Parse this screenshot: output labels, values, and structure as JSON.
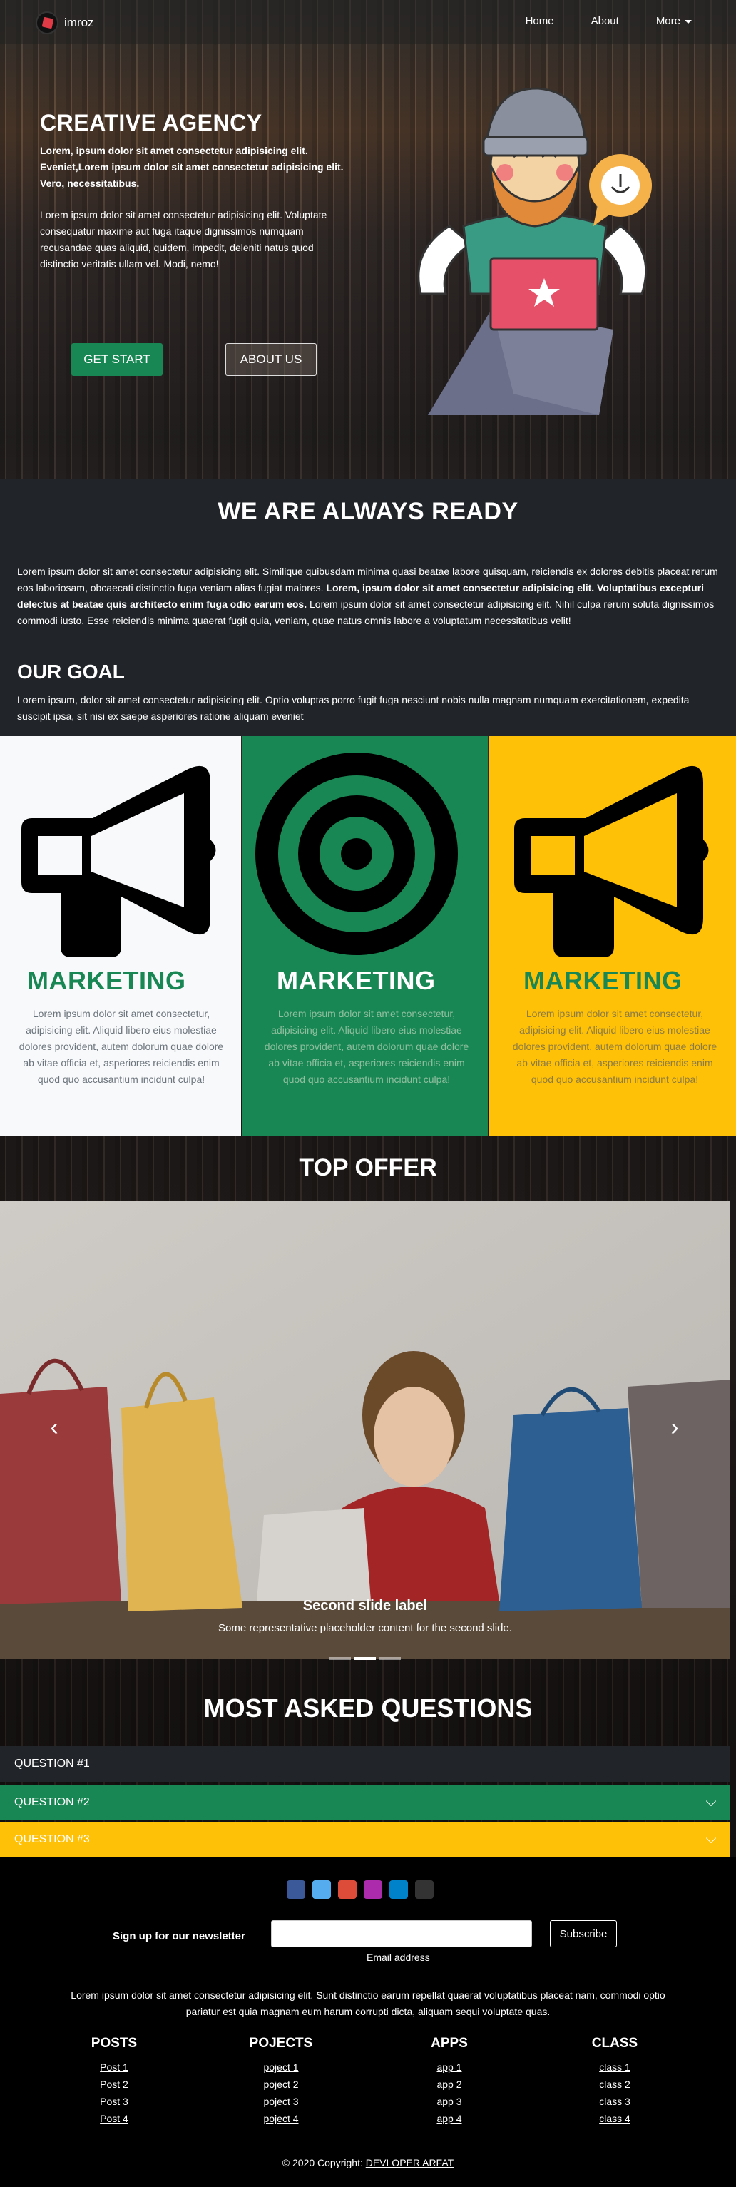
{
  "navbar": {
    "brand": "imroz",
    "links": [
      "Home",
      "About",
      "More"
    ]
  },
  "hero": {
    "title": "CREATIVE AGENCY",
    "lead": "Lorem, ipsum dolor sit amet consectetur adipisicing elit. Eveniet,Lorem ipsum dolor sit amet consectetur adipisicing elit. Vero, necessitatibus.",
    "text": "Lorem ipsum dolor sit amet consectetur adipisicing elit. Voluptate consequatur maxime aut fuga itaque dignissimos numquam recusandae quas aliquid, quidem, impedit, deleniti natus quod distinctio veritatis ullam vel. Modi, nemo!",
    "btn_start": "GET START",
    "btn_about": "ABOUT US"
  },
  "ready": {
    "title": "WE ARE ALWAYS READY",
    "text_a": "Lorem ipsum dolor sit amet consectetur adipisicing elit. Similique quibusdam minima quasi beatae labore quisquam, reiciendis ex dolores debitis placeat rerum eos laboriosam, obcaecati distinctio fuga veniam alias fugiat maiores. ",
    "text_bold": "Lorem, ipsum dolor sit amet consectetur adipisicing elit. Voluptatibus excepturi delectus at beatae quis architecto enim fuga odio earum eos.",
    "text_b": " Lorem ipsum dolor sit amet consectetur adipisicing elit. Nihil culpa rerum soluta dignissimos commodi iusto. Esse reiciendis minima quaerat fugit quia, veniam, quae natus omnis labore a voluptatum necessitatibus velit!",
    "goal_title": "OUR GOAL",
    "goal_text": "Lorem ipsum, dolor sit amet consectetur adipisicing elit. Optio voluptas porro fugit fuga nesciunt nobis nulla magnam numquam exercitationem, expedita suscipit ipsa, sit nisi ex saepe asperiores ratione aliquam eveniet"
  },
  "cards": [
    {
      "icon": "megaphone-icon",
      "title": "MARKETING",
      "text": "Lorem ipsum dolor sit amet consectetur, adipisicing elit. Aliquid libero eius molestiae dolores provident, autem dolorum quae dolore ab vitae officia et, asperiores reiciendis enim quod quo accusantium incidunt culpa!"
    },
    {
      "icon": "target-icon",
      "title": "MARKETING",
      "text": "Lorem ipsum dolor sit amet consectetur, adipisicing elit. Aliquid libero eius molestiae dolores provident, autem dolorum quae dolore ab vitae officia et, asperiores reiciendis enim quod quo accusantium incidunt culpa!"
    },
    {
      "icon": "megaphone-icon",
      "title": "MARKETING",
      "text": "Lorem ipsum dolor sit amet consectetur, adipisicing elit. Aliquid libero eius molestiae dolores provident, autem dolorum quae dolore ab vitae officia et, asperiores reiciendis enim quod quo accusantium incidunt culpa!"
    }
  ],
  "offer": {
    "title": "TOP OFFER",
    "caption_title": "Second slide label",
    "caption_text": "Some representative placeholder content for the second slide.",
    "prev_icon": "chevron-left-icon",
    "next_icon": "chevron-right-icon",
    "prev_glyph": "‹",
    "next_glyph": "›",
    "active_slide": 2,
    "slide_count": 3
  },
  "faq": {
    "title": "MOST ASKED QUESTIONS",
    "items": [
      "QUESTION #1",
      "QUESTION #2",
      "QUESTION #3"
    ]
  },
  "footer": {
    "socials": [
      {
        "icon": "facebook-icon",
        "color": "#3b5998"
      },
      {
        "icon": "twitter-icon",
        "color": "#55acee"
      },
      {
        "icon": "google-icon",
        "color": "#dd4b39"
      },
      {
        "icon": "instagram-icon",
        "color": "#ac2bac"
      },
      {
        "icon": "linkedin-icon",
        "color": "#0082ca"
      },
      {
        "icon": "github-icon",
        "color": "#333333"
      }
    ],
    "newsletter_label": "Sign up for our newsletter",
    "email_help": "Email address",
    "subscribe": "Subscribe",
    "text": "Lorem ipsum dolor sit amet consectetur adipisicing elit. Sunt distinctio earum repellat quaerat voluptatibus placeat nam, commodi optio pariatur est quia magnam eum harum corrupti dicta, aliquam sequi voluptate quas.",
    "columns": [
      {
        "title": "POSTS",
        "links": [
          "Post 1",
          "Post 2",
          "Post 3",
          "Post 4"
        ]
      },
      {
        "title": "POJECTS",
        "links": [
          "poject 1",
          "poject 2",
          "poject 3",
          "poject 4"
        ]
      },
      {
        "title": "APPS",
        "links": [
          "app 1",
          "app 2",
          "app 3",
          "app 4"
        ]
      },
      {
        "title": "CLASS",
        "links": [
          "class 1",
          "class 2",
          "class 3",
          "class 4"
        ]
      }
    ],
    "copyright_prefix": "© 2020 Copyright: ",
    "copyright_link": "DEVLOPER ARFAT"
  },
  "colors": {
    "green": "#198754",
    "yellow": "#ffc107",
    "dark": "#212529",
    "light": "#f8f9fa"
  }
}
